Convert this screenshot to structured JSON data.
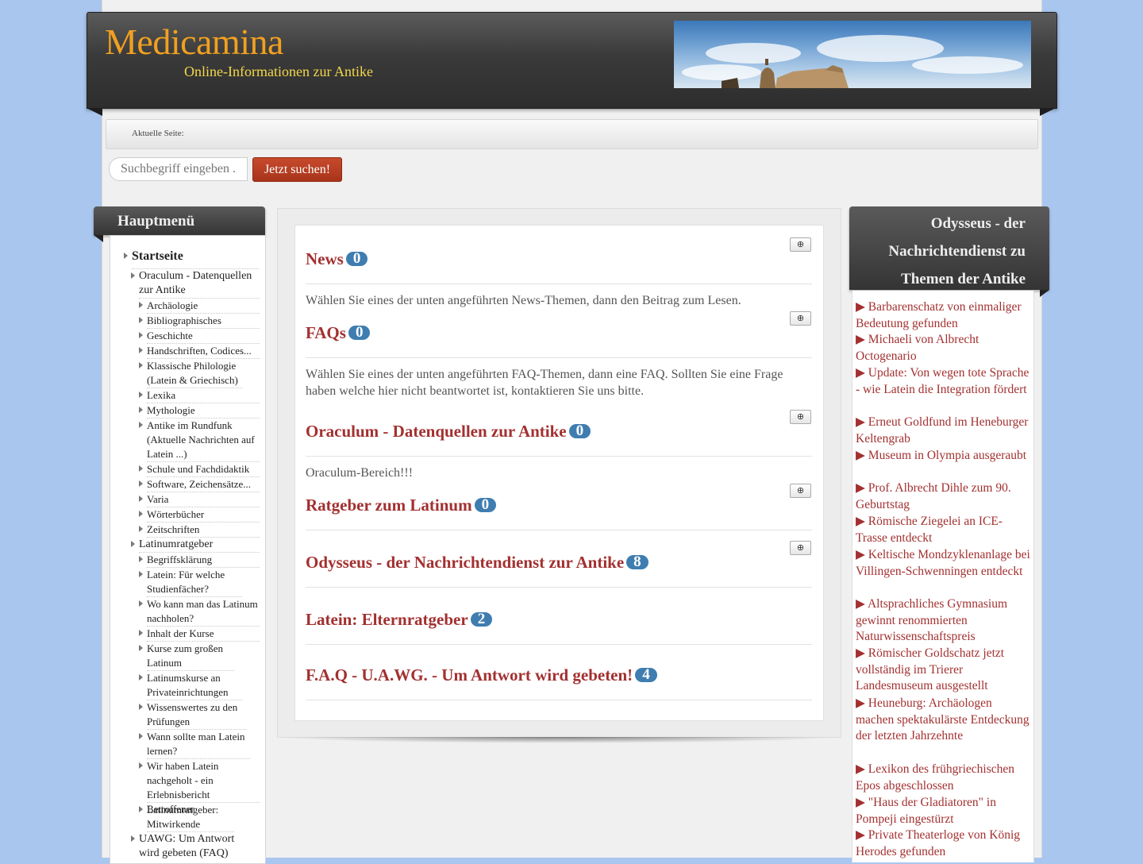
{
  "site": {
    "title": "Medicamina",
    "subtitle": "Online-Informationen zur Antike"
  },
  "breadcrumb": {
    "label": "Aktuelle Seite:"
  },
  "search": {
    "placeholder": "Suchbegriff eingeben ...",
    "button_label": "Jetzt suchen!"
  },
  "main_menu": {
    "title": "Hauptmenü",
    "items": [
      {
        "label": "Startseite"
      },
      {
        "label": "Oraculum - Datenquellen zur Antike"
      },
      {
        "label": "Archäologie"
      },
      {
        "label": "Bibliographisches"
      },
      {
        "label": "Geschichte"
      },
      {
        "label": "Handschriften, Codices..."
      },
      {
        "label": "Klassische Philologie (Latein & Griechisch)"
      },
      {
        "label": "Lexika"
      },
      {
        "label": "Mythologie"
      },
      {
        "label": "Antike im Rundfunk (Aktuelle Nachrichten auf Latein ...)"
      },
      {
        "label": "Schule und Fachdidaktik"
      },
      {
        "label": "Software, Zeichensätze..."
      },
      {
        "label": "Varia"
      },
      {
        "label": "Wörterbücher"
      },
      {
        "label": "Zeitschriften"
      },
      {
        "label": "Latinumratgeber"
      },
      {
        "label": "Begriffsklärung"
      },
      {
        "label": "Latein: Für welche Studienfächer?"
      },
      {
        "label": "Wo kann man das Latinum nachholen?"
      },
      {
        "label": "Inhalt der Kurse"
      },
      {
        "label": "Kurse zum großen Latinum"
      },
      {
        "label": "Latinumskurse an Privateinrichtungen"
      },
      {
        "label": "Wissenswertes zu den Prüfungen"
      },
      {
        "label": "Wann sollte man Latein lernen?"
      },
      {
        "label": "Wir haben Latein nachgeholt - ein Erlebnisbericht Betroffener"
      },
      {
        "label": "Latinumratgeber: Mitwirkende"
      },
      {
        "label": "UAWG: Um Antwort wird gebeten (FAQ)"
      }
    ]
  },
  "categories": {
    "expand_symbol": "⊕",
    "items": [
      {
        "title": "News",
        "count": "0",
        "description": "Wählen Sie eines der unten angeführten News-Themen, dann den Beitrag zum Lesen."
      },
      {
        "title": "FAQs",
        "count": "0",
        "description": "Wählen Sie eines der unten angeführten FAQ-Themen, dann eine FAQ. Sollten Sie eine Frage haben welche hier nicht beantwortet ist, kontaktieren Sie uns bitte."
      },
      {
        "title": "Oraculum - Datenquellen zur Antike",
        "count": "0",
        "description": "Oraculum-Bereich!!!"
      },
      {
        "title": "Ratgeber zum Latinum",
        "count": "0",
        "description": ""
      },
      {
        "title": "Odysseus - der Nachrichtendienst zur Antike",
        "count": "8",
        "description": ""
      },
      {
        "title": "Latein: Elternratgeber",
        "count": "2",
        "description": ""
      },
      {
        "title": "F.A.Q - U.A.WG. - Um Antwort wird gebeten!",
        "count": "4",
        "description": ""
      }
    ]
  },
  "news_panel": {
    "title": "Odysseus - der Nachrichtendienst zu Themen der Antike",
    "items": [
      {
        "label": "▶ Barbarenschatz von einmaliger Bedeutung gefunden"
      },
      {
        "label": "▶ Michaeli von Albrecht Octogenario"
      },
      {
        "label": "▶ Update: Von wegen tote Sprache - wie Latein die Integration fördert"
      },
      {
        "label": "▶ Erneut Goldfund im Heneburger Keltengrab"
      },
      {
        "label": "▶ Museum in Olympia ausgeraubt"
      },
      {
        "label": "▶ Prof. Albrecht Dihle zum 90. Geburtstag"
      },
      {
        "label": "▶ Römische Ziegelei an ICE-Trasse entdeckt"
      },
      {
        "label": "▶ Keltische Mondzyklenanlage bei Villingen-Schwenningen entdeckt"
      },
      {
        "label": "▶ Altsprachliches Gymnasium gewinnt renommierten Naturwissenschaftspreis"
      },
      {
        "label": "▶ Römischer Goldschatz jetzt vollständig im Trierer Landesmuseum ausgestellt"
      },
      {
        "label": "▶ Heuneburg: Archäologen machen spektakulärste Entdeckung der letzten Jahrzehnte"
      },
      {
        "label": "▶ Lexikon des frühgriechischen Epos abgeschlossen"
      },
      {
        "label": "▶ \"Haus der Gladiatoren\" in Pompeji eingestürzt"
      },
      {
        "label": "▶ Private Theaterloge von König Herodes gefunden"
      }
    ]
  },
  "colors": {
    "background": "#a9c6ee",
    "header": "#3a3a3a",
    "site_title": "#f0a020",
    "subtitle": "#f3d74a",
    "link": "#a33030",
    "badge": "#3f7db0",
    "search_button": "#b73d22"
  }
}
